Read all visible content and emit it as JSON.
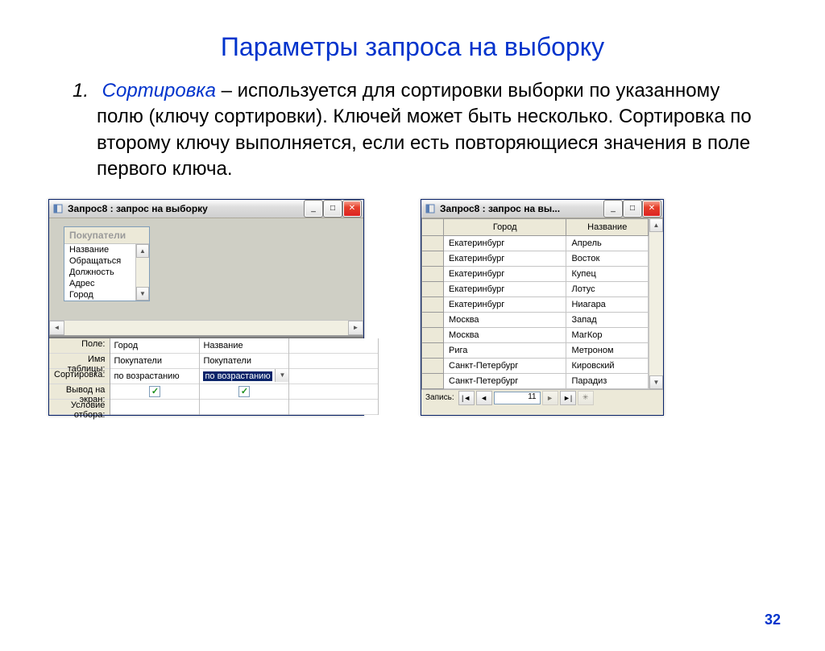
{
  "title": "Параметры запроса на выборку",
  "item_number": "1.",
  "term": "Сортировка",
  "description": " – используется для сортировки выборки по указанному полю (ключу сортировки). Ключей может быть несколько. Сортировка по второму ключу выполняется, если есть повторяющиеся значения в поле первого ключа.",
  "page_number": "32",
  "design": {
    "window_title": "Запрос8 : запрос на выборку",
    "field_list_title": "Покупатели",
    "fields": [
      "Название",
      "Обращаться",
      "Должность",
      "Адрес",
      "Город"
    ],
    "row_labels": [
      "Поле:",
      "Имя таблицы:",
      "Сортировка:",
      "Вывод на экран:",
      "Условие отбора:"
    ],
    "cols": [
      {
        "field": "Город",
        "table": "Покупатели",
        "sort": "по возрастанию",
        "selected": false
      },
      {
        "field": "Название",
        "table": "Покупатели",
        "sort": "по возрастанию",
        "selected": true
      }
    ]
  },
  "datasheet": {
    "window_title": "Запрос8 : запрос на вы...",
    "headers": [
      "Город",
      "Название"
    ],
    "rows": [
      [
        "Екатеринбург",
        "Апрель"
      ],
      [
        "Екатеринбург",
        "Восток"
      ],
      [
        "Екатеринбург",
        "Купец"
      ],
      [
        "Екатеринбург",
        "Лотус"
      ],
      [
        "Екатеринбург",
        "Ниагара"
      ],
      [
        "Москва",
        "Запад"
      ],
      [
        "Москва",
        "МагКор"
      ],
      [
        "Рига",
        "Метроном"
      ],
      [
        "Санкт-Петербург",
        "Кировский"
      ],
      [
        "Санкт-Петербург",
        "Парадиз"
      ]
    ],
    "record_label": "Запись:",
    "record_value": "11"
  }
}
